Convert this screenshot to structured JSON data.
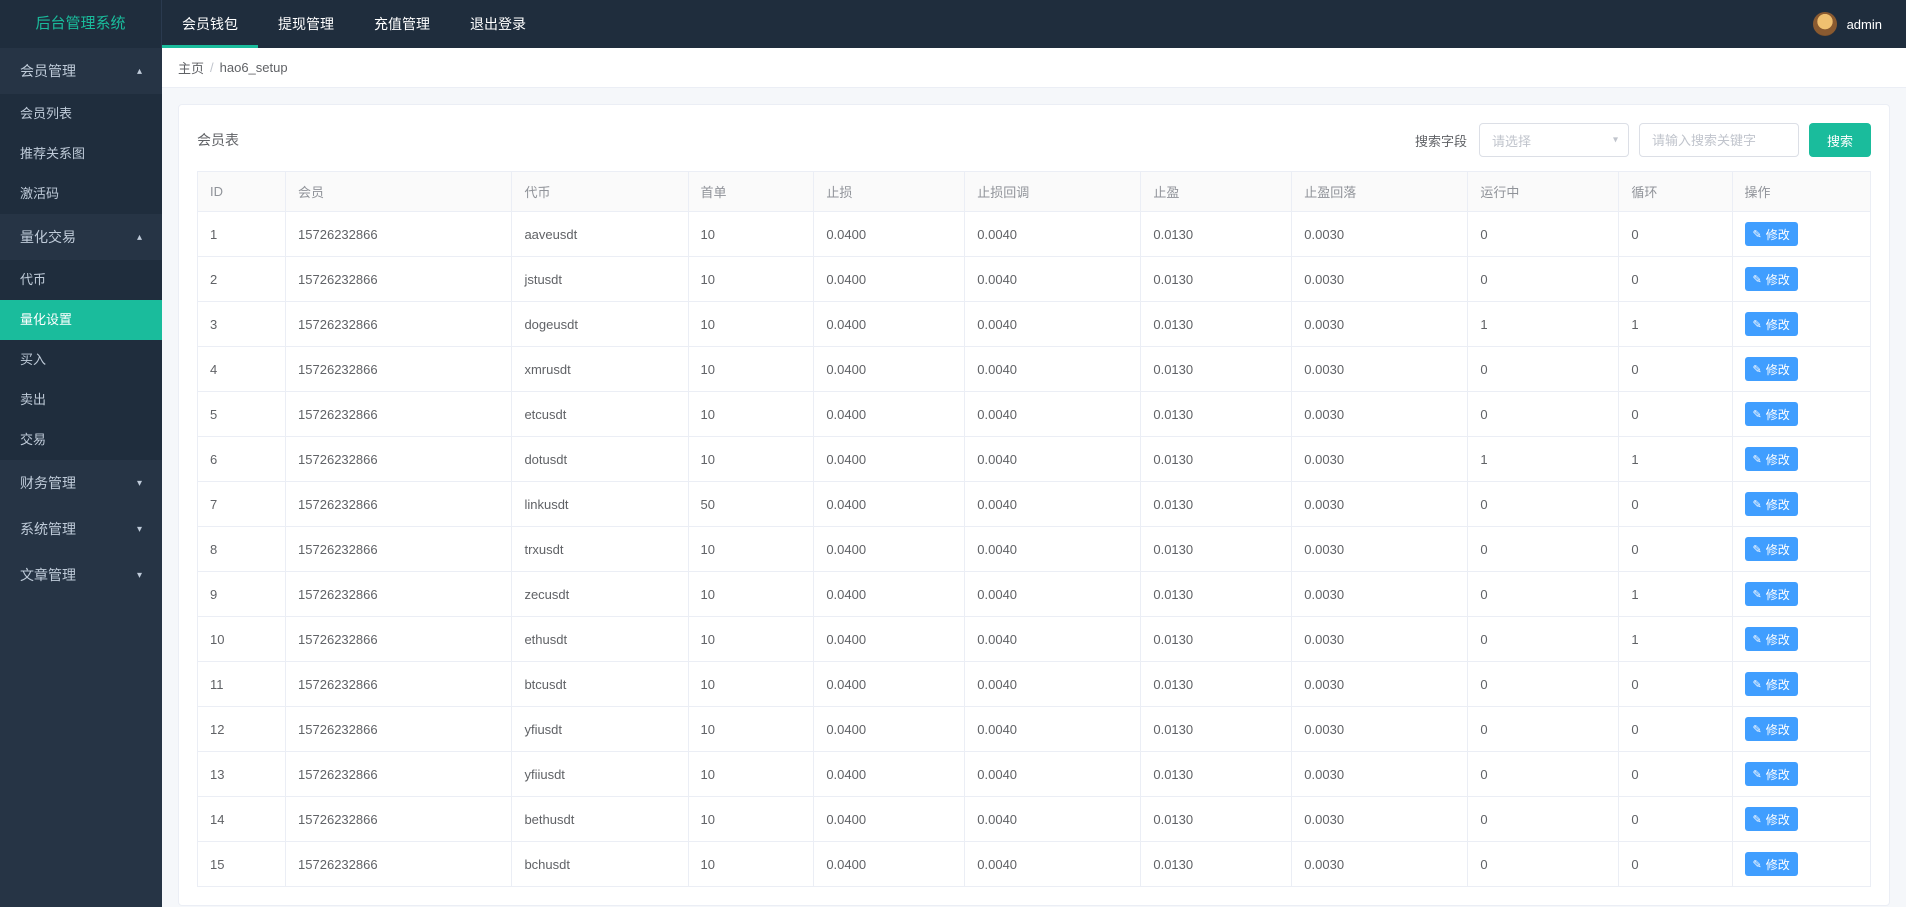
{
  "brand": "后台管理系统",
  "topnav": {
    "items": [
      {
        "label": "会员钱包",
        "active": true
      },
      {
        "label": "提现管理",
        "active": false
      },
      {
        "label": "充值管理",
        "active": false
      },
      {
        "label": "退出登录",
        "active": false
      }
    ]
  },
  "user": {
    "name": "admin"
  },
  "sidebar": [
    {
      "title": "会员管理",
      "expanded": true,
      "children": [
        {
          "label": "会员列表",
          "active": false
        },
        {
          "label": "推荐关系图",
          "active": false
        },
        {
          "label": "激活码",
          "active": false
        }
      ]
    },
    {
      "title": "量化交易",
      "expanded": true,
      "children": [
        {
          "label": "代币",
          "active": false
        },
        {
          "label": "量化设置",
          "active": true
        },
        {
          "label": "买入",
          "active": false
        },
        {
          "label": "卖出",
          "active": false
        },
        {
          "label": "交易",
          "active": false
        }
      ]
    },
    {
      "title": "财务管理",
      "expanded": false,
      "children": []
    },
    {
      "title": "系统管理",
      "expanded": false,
      "children": []
    },
    {
      "title": "文章管理",
      "expanded": false,
      "children": []
    }
  ],
  "breadcrumb": {
    "home": "主页",
    "current": "hao6_setup"
  },
  "card": {
    "title": "会员表",
    "search_field_label": "搜索字段",
    "select_placeholder": "请选择",
    "input_placeholder": "请输入搜索关键字",
    "search_button": "搜索"
  },
  "table": {
    "columns": [
      "ID",
      "会员",
      "代币",
      "首单",
      "止损",
      "止损回调",
      "止盈",
      "止盈回落",
      "运行中",
      "循环",
      "操作"
    ],
    "edit_label": "修改",
    "rows": [
      {
        "id": "1",
        "member": "15726232866",
        "token": "aaveusdt",
        "first": "10",
        "stop": "0.0400",
        "stop_cb": "0.0040",
        "profit": "0.0130",
        "profit_cb": "0.0030",
        "running": "0",
        "loop": "0"
      },
      {
        "id": "2",
        "member": "15726232866",
        "token": "jstusdt",
        "first": "10",
        "stop": "0.0400",
        "stop_cb": "0.0040",
        "profit": "0.0130",
        "profit_cb": "0.0030",
        "running": "0",
        "loop": "0"
      },
      {
        "id": "3",
        "member": "15726232866",
        "token": "dogeusdt",
        "first": "10",
        "stop": "0.0400",
        "stop_cb": "0.0040",
        "profit": "0.0130",
        "profit_cb": "0.0030",
        "running": "1",
        "loop": "1"
      },
      {
        "id": "4",
        "member": "15726232866",
        "token": "xmrusdt",
        "first": "10",
        "stop": "0.0400",
        "stop_cb": "0.0040",
        "profit": "0.0130",
        "profit_cb": "0.0030",
        "running": "0",
        "loop": "0"
      },
      {
        "id": "5",
        "member": "15726232866",
        "token": "etcusdt",
        "first": "10",
        "stop": "0.0400",
        "stop_cb": "0.0040",
        "profit": "0.0130",
        "profit_cb": "0.0030",
        "running": "0",
        "loop": "0"
      },
      {
        "id": "6",
        "member": "15726232866",
        "token": "dotusdt",
        "first": "10",
        "stop": "0.0400",
        "stop_cb": "0.0040",
        "profit": "0.0130",
        "profit_cb": "0.0030",
        "running": "1",
        "loop": "1"
      },
      {
        "id": "7",
        "member": "15726232866",
        "token": "linkusdt",
        "first": "50",
        "stop": "0.0400",
        "stop_cb": "0.0040",
        "profit": "0.0130",
        "profit_cb": "0.0030",
        "running": "0",
        "loop": "0"
      },
      {
        "id": "8",
        "member": "15726232866",
        "token": "trxusdt",
        "first": "10",
        "stop": "0.0400",
        "stop_cb": "0.0040",
        "profit": "0.0130",
        "profit_cb": "0.0030",
        "running": "0",
        "loop": "0"
      },
      {
        "id": "9",
        "member": "15726232866",
        "token": "zecusdt",
        "first": "10",
        "stop": "0.0400",
        "stop_cb": "0.0040",
        "profit": "0.0130",
        "profit_cb": "0.0030",
        "running": "0",
        "loop": "1"
      },
      {
        "id": "10",
        "member": "15726232866",
        "token": "ethusdt",
        "first": "10",
        "stop": "0.0400",
        "stop_cb": "0.0040",
        "profit": "0.0130",
        "profit_cb": "0.0030",
        "running": "0",
        "loop": "1"
      },
      {
        "id": "11",
        "member": "15726232866",
        "token": "btcusdt",
        "first": "10",
        "stop": "0.0400",
        "stop_cb": "0.0040",
        "profit": "0.0130",
        "profit_cb": "0.0030",
        "running": "0",
        "loop": "0"
      },
      {
        "id": "12",
        "member": "15726232866",
        "token": "yfiusdt",
        "first": "10",
        "stop": "0.0400",
        "stop_cb": "0.0040",
        "profit": "0.0130",
        "profit_cb": "0.0030",
        "running": "0",
        "loop": "0"
      },
      {
        "id": "13",
        "member": "15726232866",
        "token": "yfiiusdt",
        "first": "10",
        "stop": "0.0400",
        "stop_cb": "0.0040",
        "profit": "0.0130",
        "profit_cb": "0.0030",
        "running": "0",
        "loop": "0"
      },
      {
        "id": "14",
        "member": "15726232866",
        "token": "bethusdt",
        "first": "10",
        "stop": "0.0400",
        "stop_cb": "0.0040",
        "profit": "0.0130",
        "profit_cb": "0.0030",
        "running": "0",
        "loop": "0"
      },
      {
        "id": "15",
        "member": "15726232866",
        "token": "bchusdt",
        "first": "10",
        "stop": "0.0400",
        "stop_cb": "0.0040",
        "profit": "0.0130",
        "profit_cb": "0.0030",
        "running": "0",
        "loop": "0"
      }
    ]
  }
}
